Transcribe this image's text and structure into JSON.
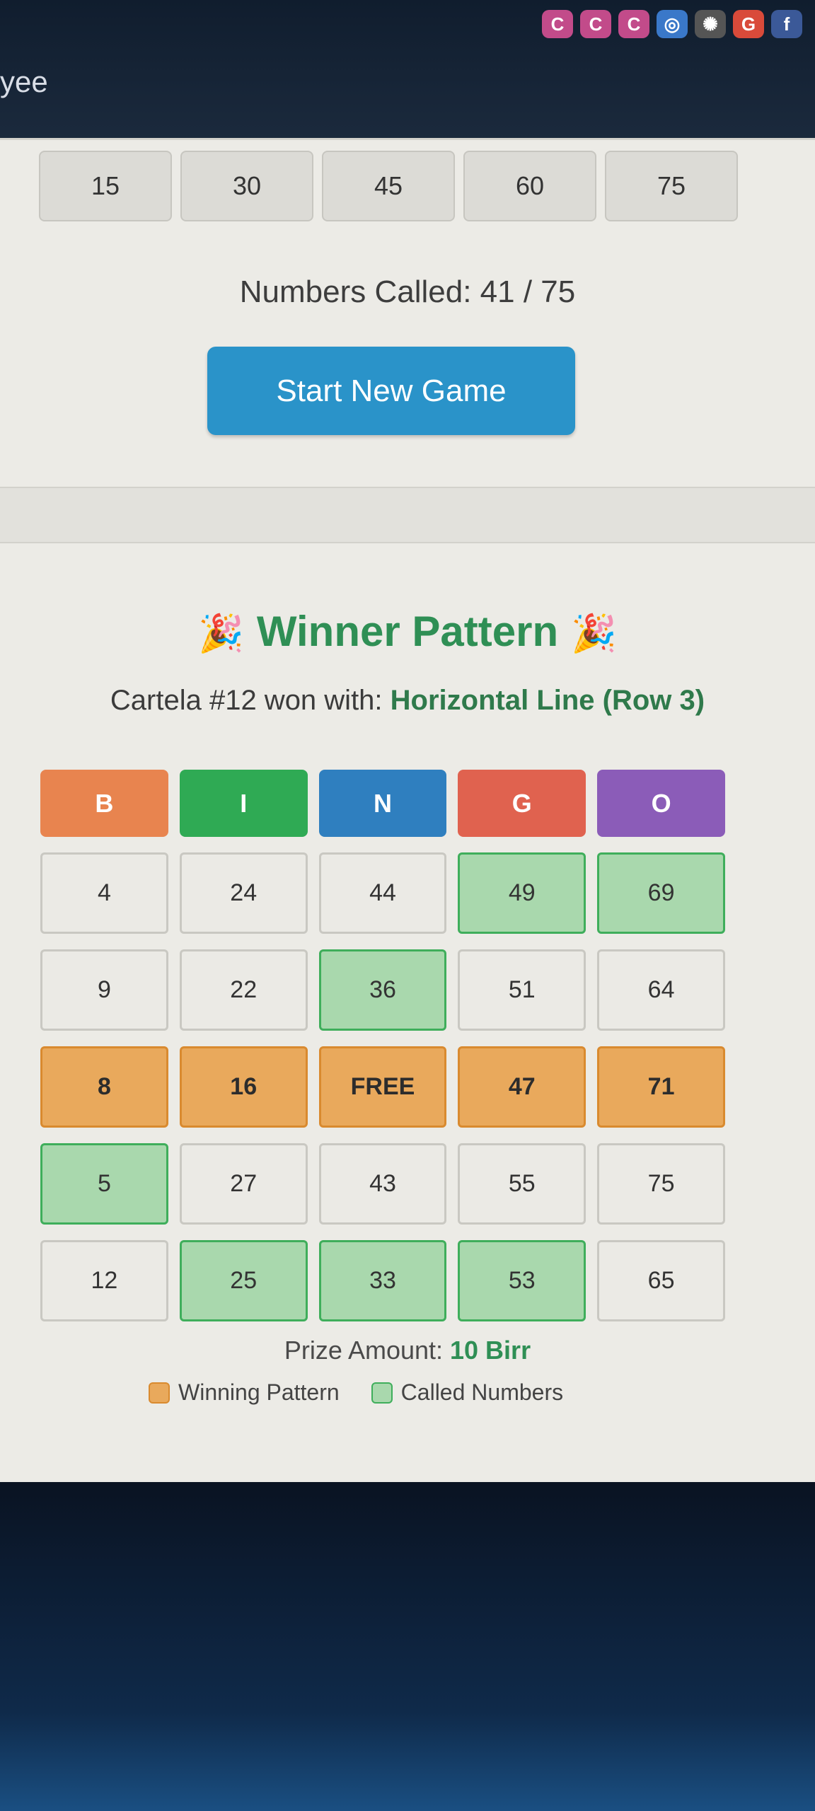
{
  "tab_title": "yee",
  "extension_icons": [
    {
      "name": "pink-extension-icon",
      "glyph": "C",
      "color": "#c24b8a"
    },
    {
      "name": "pink-extension-icon-2",
      "glyph": "C",
      "color": "#c24b8a"
    },
    {
      "name": "pink-extension-icon-3",
      "glyph": "C",
      "color": "#c24b8a"
    },
    {
      "name": "chrome-icon",
      "glyph": "◎",
      "color": "#3a78c9"
    },
    {
      "name": "openai-icon",
      "glyph": "✺",
      "color": "#555"
    },
    {
      "name": "google-icon",
      "glyph": "G",
      "color": "#d94a3a"
    },
    {
      "name": "facebook-icon",
      "glyph": "f",
      "color": "#3b5998"
    }
  ],
  "column_totals": [
    "15",
    "30",
    "45",
    "60",
    "75"
  ],
  "numbers_called": "Numbers Called: 41 / 75",
  "start_button_label": "Start New Game",
  "winner": {
    "title": "Winner Pattern",
    "party_emoji": "🎉",
    "cartela_text": "Cartela #12 won with: ",
    "pattern": "Horizontal Line (Row 3)"
  },
  "bingo_headers": [
    {
      "letter": "B",
      "color": "#e8844f"
    },
    {
      "letter": "I",
      "color": "#2faa54"
    },
    {
      "letter": "N",
      "color": "#2f7fbf"
    },
    {
      "letter": "G",
      "color": "#e0624f"
    },
    {
      "letter": "O",
      "color": "#8b5cb8"
    }
  ],
  "card": [
    [
      {
        "v": "4",
        "s": ""
      },
      {
        "v": "24",
        "s": ""
      },
      {
        "v": "44",
        "s": ""
      },
      {
        "v": "49",
        "s": "called"
      },
      {
        "v": "69",
        "s": "called"
      }
    ],
    [
      {
        "v": "9",
        "s": ""
      },
      {
        "v": "22",
        "s": ""
      },
      {
        "v": "36",
        "s": "called"
      },
      {
        "v": "51",
        "s": ""
      },
      {
        "v": "64",
        "s": ""
      }
    ],
    [
      {
        "v": "8",
        "s": "win"
      },
      {
        "v": "16",
        "s": "win"
      },
      {
        "v": "FREE",
        "s": "win"
      },
      {
        "v": "47",
        "s": "win"
      },
      {
        "v": "71",
        "s": "win"
      }
    ],
    [
      {
        "v": "5",
        "s": "called"
      },
      {
        "v": "27",
        "s": ""
      },
      {
        "v": "43",
        "s": ""
      },
      {
        "v": "55",
        "s": ""
      },
      {
        "v": "75",
        "s": ""
      }
    ],
    [
      {
        "v": "12",
        "s": ""
      },
      {
        "v": "25",
        "s": "called"
      },
      {
        "v": "33",
        "s": "called"
      },
      {
        "v": "53",
        "s": "called"
      },
      {
        "v": "65",
        "s": ""
      }
    ]
  ],
  "prize": {
    "label": "Prize Amount: ",
    "amount": "10 Birr"
  },
  "legend": [
    {
      "label": "Winning Pattern",
      "color": "#e9a95c"
    },
    {
      "label": "Called Numbers",
      "color": "#a9d8ad"
    }
  ]
}
